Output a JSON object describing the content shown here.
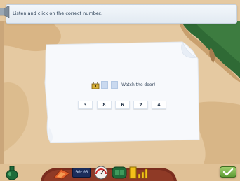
{
  "instruction": {
    "text": "Listen and click on the correct number."
  },
  "puzzle": {
    "hint": "- Watch the door!",
    "separator": "-"
  },
  "number_options": [
    "3",
    "8",
    "6",
    "2",
    "4"
  ],
  "toolbar": {
    "clock_display": "00:00",
    "icons": [
      "potion-icon",
      "paintbrush-icon",
      "clock-icon",
      "gauge-icon",
      "book-icon",
      "chart-icon",
      "check-icon"
    ]
  },
  "colors": {
    "background": "#e5c9a1",
    "map_green": "#2f6a35",
    "instruction_bar": "#e8eef5",
    "paper": "#f7f9fc",
    "code_box": "#c9d9ef",
    "bottom_bar": "#7a2d1e"
  }
}
